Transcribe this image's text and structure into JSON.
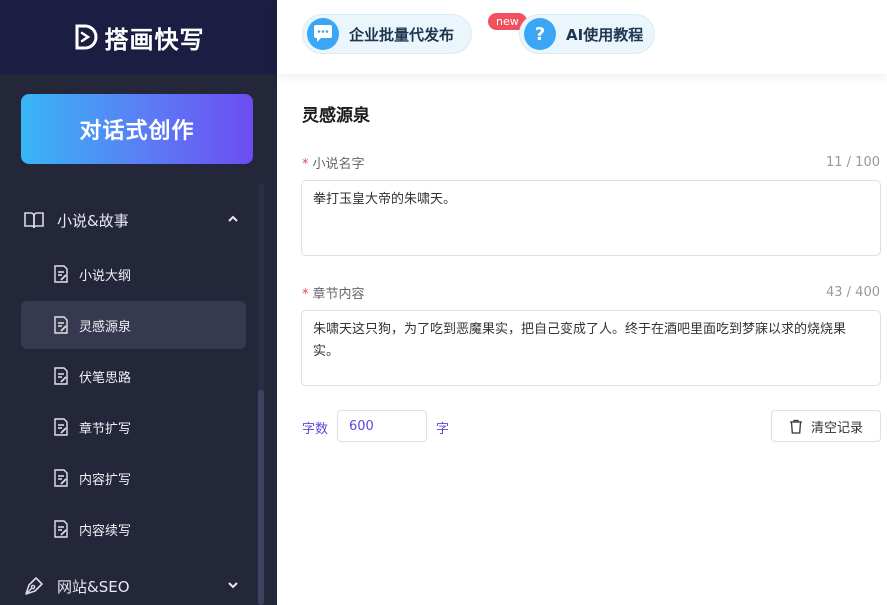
{
  "app": {
    "logo_text": "搭画快写"
  },
  "sidebar": {
    "cta_label": "对话式创作",
    "groups": [
      {
        "label": "小说&故事",
        "icon": "book-icon",
        "expanded": true,
        "items": [
          {
            "label": "小说大纲",
            "active": false
          },
          {
            "label": "灵感源泉",
            "active": true
          },
          {
            "label": "伏笔思路",
            "active": false
          },
          {
            "label": "章节扩写",
            "active": false
          },
          {
            "label": "内容扩写",
            "active": false
          },
          {
            "label": "内容续写",
            "active": false
          }
        ]
      },
      {
        "label": "网站&SEO",
        "icon": "pen-nib-icon",
        "expanded": false
      }
    ]
  },
  "header": {
    "batch_button": "企业批量代发布",
    "badge": "new",
    "tutorial_button": "AI使用教程",
    "tutorial_icon_glyph": "?"
  },
  "main": {
    "title": "灵感源泉",
    "novel_name": {
      "label": "小说名字",
      "required_mark": "*",
      "counter": "11 / 100",
      "value": "拳打玉皇大帝的朱啸天。"
    },
    "chapter_content": {
      "label": "章节内容",
      "required_mark": "*",
      "counter": "43 / 400",
      "value": "朱啸天这只狗，为了吃到恶魔果实，把自己变成了人。终于在酒吧里面吃到梦寐以求的烧烧果实。"
    },
    "word_count": {
      "label": "字数",
      "value": "600",
      "unit": "字"
    },
    "clear_button": "清空记录"
  },
  "colors": {
    "sidebar_bg": "#24263a",
    "logo_bar_bg": "#1c1d42",
    "accent_purple": "#5b47d8",
    "badge_red": "#f3505f",
    "pill_blue": "#3aa6f4"
  }
}
